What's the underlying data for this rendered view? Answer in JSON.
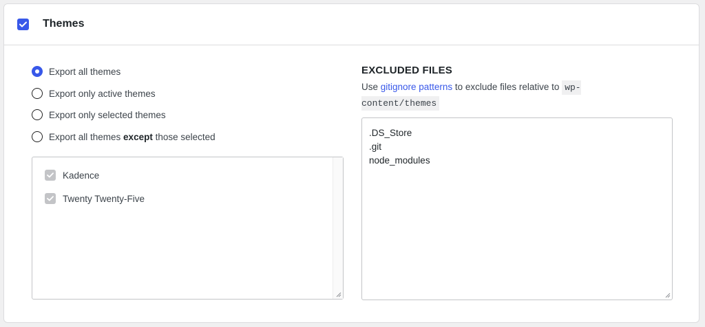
{
  "header": {
    "title": "Themes",
    "checked": true,
    "accent_color": "#3858e9"
  },
  "export_options": [
    {
      "label": "Export all themes",
      "selected": true
    },
    {
      "label": "Export only active themes",
      "selected": false
    },
    {
      "label": "Export only selected themes",
      "selected": false
    },
    {
      "label_before": "Export all themes ",
      "label_bold": "except",
      "label_after": " those selected",
      "selected": false
    }
  ],
  "themes": [
    {
      "name": "Kadence",
      "checked": true,
      "disabled": true
    },
    {
      "name": "Twenty Twenty-Five",
      "checked": true,
      "disabled": true
    }
  ],
  "excluded_files": {
    "title": "EXCLUDED FILES",
    "desc_prefix": "Use ",
    "link_text": "gitignore patterns",
    "desc_suffix": " to exclude files relative to ",
    "path_code": "wp-content/themes",
    "patterns": [
      ".DS_Store",
      ".git",
      "node_modules"
    ]
  }
}
